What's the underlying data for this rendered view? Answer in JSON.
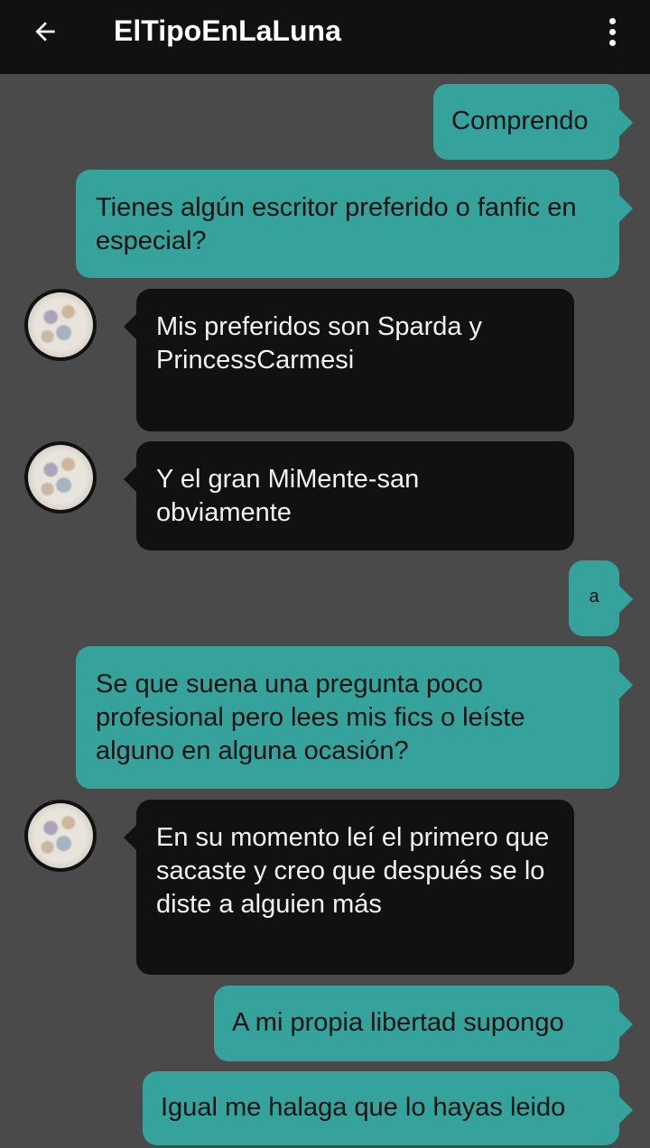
{
  "header": {
    "title": "ElTipoEnLaLuna",
    "back_icon": "arrow-left-icon",
    "menu_icon": "more-vertical-icon"
  },
  "colors": {
    "outgoing_bubble": "#35a39b",
    "incoming_bubble": "#111111",
    "background": "#4a4a4a",
    "topbar": "#111111"
  },
  "messages": [
    {
      "side": "out",
      "text": "Comprendo"
    },
    {
      "side": "out",
      "text": "Tienes algún escritor preferido o fanfic en especial?"
    },
    {
      "side": "in",
      "text": "Mis preferidos son Sparda y PrincessCarmesi"
    },
    {
      "side": "in",
      "text": "Y el gran MiMente-san obviamente"
    },
    {
      "side": "out",
      "text": "a"
    },
    {
      "side": "out",
      "text": "Se que suena una pregunta poco profesional pero lees mis fics o leíste alguno en alguna ocasión?"
    },
    {
      "side": "in",
      "text": "En su momento leí el primero que sacaste y creo que después se lo diste a alguien más"
    },
    {
      "side": "out",
      "text": "A mi propia libertad supongo"
    },
    {
      "side": "out",
      "text": "Igual me halaga que lo hayas leido"
    }
  ]
}
